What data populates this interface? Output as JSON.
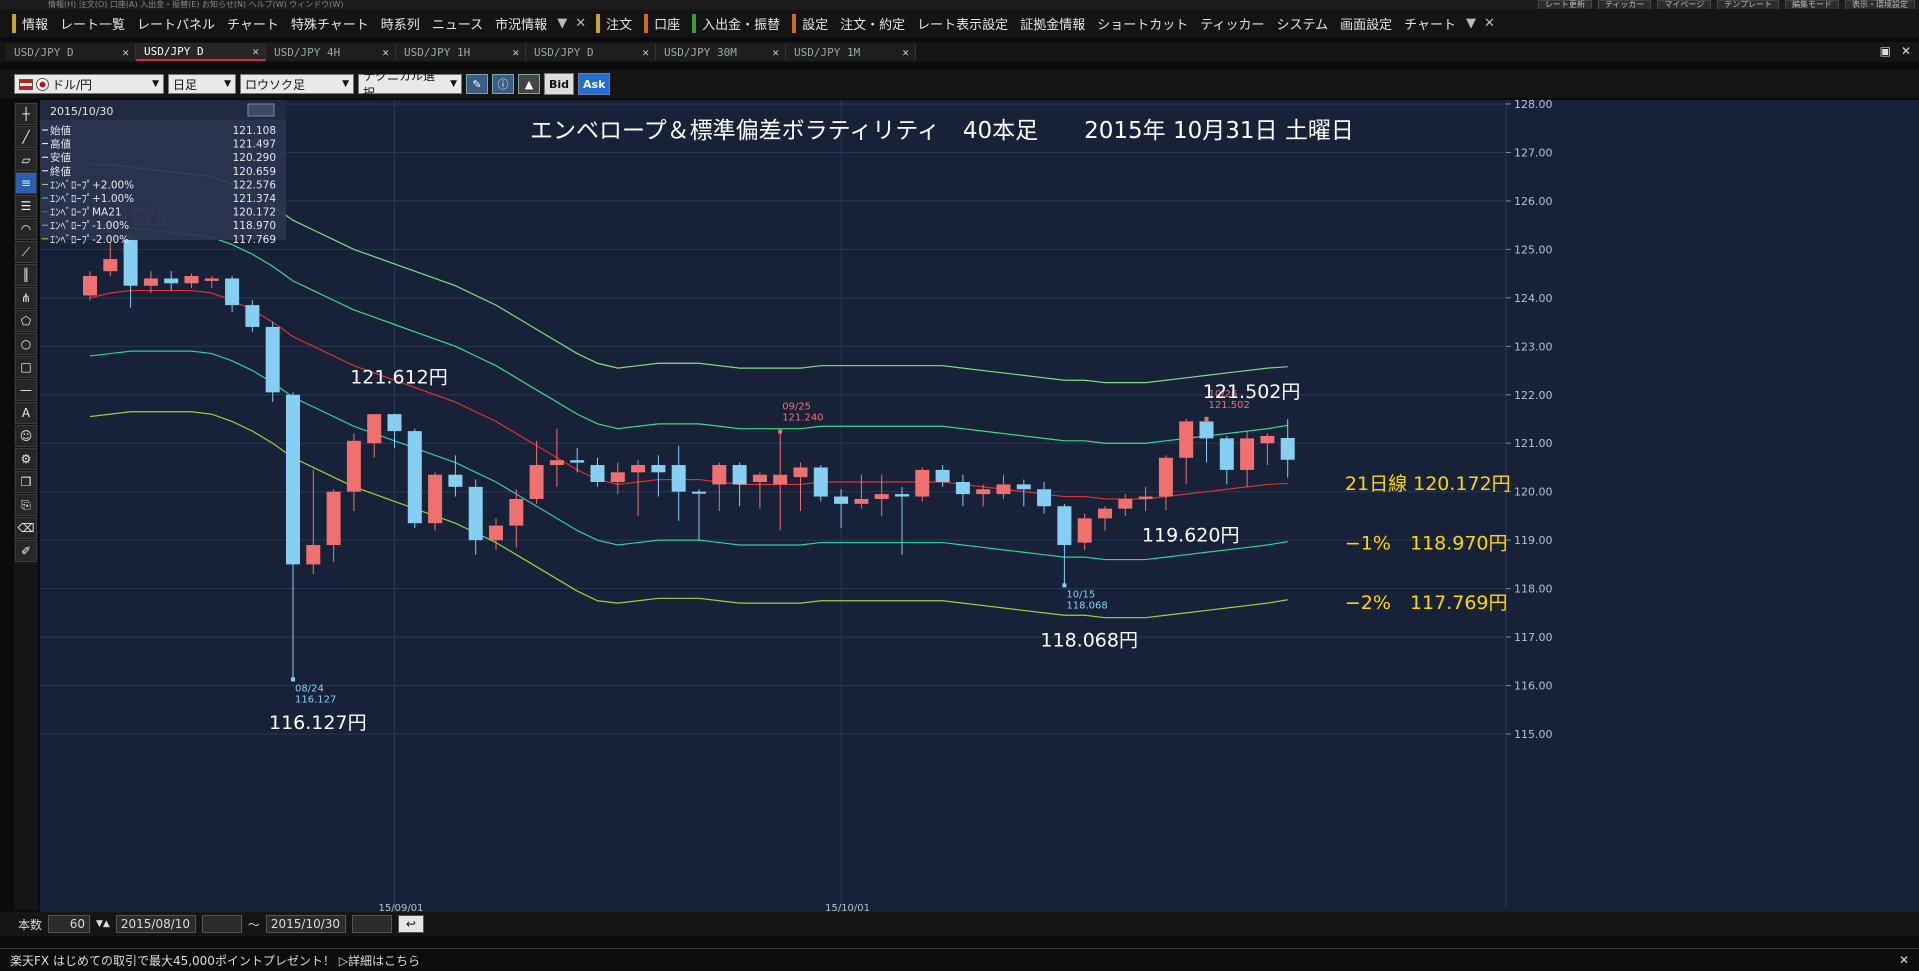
{
  "top_strip": {
    "left_items": [
      "情報(H)",
      "注文(O)",
      "口座(A)",
      "入出金・振替(E)",
      "お知らせ(N)",
      "ヘルプ(W)",
      "ウィンドウ(W)"
    ],
    "right_buttons": [
      "レート更新",
      "ティッカー",
      "マイページ",
      "テンプレート",
      "編集モード",
      "表示・環境設定"
    ]
  },
  "menu": {
    "group1": [
      "情報"
    ],
    "items": [
      "レート一覧",
      "レートパネル",
      "チャート",
      "特殊チャート",
      "時系列",
      "ニュース",
      "市況情報"
    ],
    "order": "注文",
    "account": "口座",
    "deposit": "入出金・振替",
    "settings": [
      "設定",
      "注文・約定",
      "レート表示設定",
      "証拠金情報",
      "ショートカット",
      "ティッカー",
      "システム",
      "画面設定",
      "チャート"
    ]
  },
  "tabs": [
    {
      "label": "USD/JPY D",
      "active": false
    },
    {
      "label": "USD/JPY D",
      "active": true
    },
    {
      "label": "USD/JPY 4H",
      "active": false
    },
    {
      "label": "USD/JPY 1H",
      "active": false
    },
    {
      "label": "USD/JPY D",
      "active": false
    },
    {
      "label": "USD/JPY 30M",
      "active": false
    },
    {
      "label": "USD/JPY 1M",
      "active": false
    }
  ],
  "chart_controls": {
    "pair": "ドル/円",
    "period": "日足",
    "chart_type": "ロウソク足",
    "technical": "テクニカル選択",
    "bid": "Bid",
    "ask": "Ask"
  },
  "info_panel": {
    "date": "2015/10/30",
    "rows": [
      {
        "label": "始値",
        "value": "121.108",
        "color": "#ffffff"
      },
      {
        "label": "高値",
        "value": "121.497",
        "color": "#ffffff"
      },
      {
        "label": "安値",
        "value": "120.290",
        "color": "#ffffff"
      },
      {
        "label": "終値",
        "value": "120.659",
        "color": "#ffffff"
      },
      {
        "label": "ｴﾝﾍﾞﾛｰﾌﾟ+2.00%",
        "value": "122.576",
        "color": "#8fe08f"
      },
      {
        "label": "ｴﾝﾍﾞﾛｰﾌﾟ+1.00%",
        "value": "121.374",
        "color": "#3ddc84"
      },
      {
        "label": "ｴﾝﾍﾞﾛｰﾌﾟMA21",
        "value": "120.172",
        "color": "#e03030"
      },
      {
        "label": "ｴﾝﾍﾞﾛｰﾌﾟ-1.00%",
        "value": "118.970",
        "color": "#3ddc84"
      },
      {
        "label": "ｴﾝﾍﾞﾛｰﾌﾟ-2.00%",
        "value": "117.769",
        "color": "#9bd33a"
      }
    ]
  },
  "bottom": {
    "count_label": "本数",
    "count": "60",
    "from": "2015/08/10",
    "tilde": "～",
    "to": "2015/10/30"
  },
  "news": "楽天FX はじめての取引で最大45,000ポイントプレゼント！ ▷詳細はこちら",
  "chart_data": {
    "type": "candlestick",
    "title": "エンベロープ＆標準偏差ボラティリティ　40本足　　2015年 10月31日 土曜日",
    "ylim": [
      115.0,
      128.0
    ],
    "yticks": [
      "115.00",
      "116.00",
      "117.00",
      "118.00",
      "119.00",
      "120.00",
      "121.00",
      "122.00",
      "123.00",
      "124.00",
      "125.00",
      "126.00",
      "127.00",
      "128.00"
    ],
    "xticks": [
      {
        "label": "15/09/01",
        "index": 15
      },
      {
        "label": "15/10/01",
        "index": 37
      }
    ],
    "colors": {
      "up": "#f07070",
      "down": "#86cff3"
    },
    "candles": [
      {
        "date": "08/10",
        "o": 124.05,
        "h": 124.55,
        "l": 123.95,
        "c": 124.45
      },
      {
        "date": "08/11",
        "o": 124.55,
        "h": 125.15,
        "l": 124.45,
        "c": 124.8
      },
      {
        "date": "08/12",
        "o": 125.2,
        "h": 125.281,
        "l": 123.8,
        "c": 124.25
      },
      {
        "date": "08/13",
        "o": 124.25,
        "h": 124.55,
        "l": 124.1,
        "c": 124.4
      },
      {
        "date": "08/14",
        "o": 124.4,
        "h": 124.55,
        "l": 124.15,
        "c": 124.3
      },
      {
        "date": "08/17",
        "o": 124.3,
        "h": 124.5,
        "l": 124.2,
        "c": 124.45
      },
      {
        "date": "08/18",
        "o": 124.35,
        "h": 124.45,
        "l": 124.2,
        "c": 124.4
      },
      {
        "date": "08/19",
        "o": 124.4,
        "h": 124.45,
        "l": 123.7,
        "c": 123.85
      },
      {
        "date": "08/20",
        "o": 123.85,
        "h": 123.95,
        "l": 123.3,
        "c": 123.4
      },
      {
        "date": "08/21",
        "o": 123.4,
        "h": 123.5,
        "l": 121.85,
        "c": 122.05
      },
      {
        "date": "08/24",
        "o": 122.0,
        "h": 122.05,
        "l": 116.127,
        "c": 118.5
      },
      {
        "date": "08/25",
        "o": 118.5,
        "h": 120.45,
        "l": 118.3,
        "c": 118.9
      },
      {
        "date": "08/26",
        "o": 118.9,
        "h": 120.05,
        "l": 118.55,
        "c": 120.0
      },
      {
        "date": "08/27",
        "o": 120.0,
        "h": 121.2,
        "l": 119.6,
        "c": 121.05
      },
      {
        "date": "08/28",
        "o": 121.0,
        "h": 121.6,
        "l": 120.7,
        "c": 121.6
      },
      {
        "date": "08/31",
        "o": 121.6,
        "h": 121.612,
        "l": 120.9,
        "c": 121.25
      },
      {
        "date": "09/01",
        "o": 121.25,
        "h": 121.3,
        "l": 119.25,
        "c": 119.35
      },
      {
        "date": "09/02",
        "o": 119.35,
        "h": 120.4,
        "l": 119.2,
        "c": 120.35
      },
      {
        "date": "09/03",
        "o": 120.35,
        "h": 120.75,
        "l": 119.9,
        "c": 120.1
      },
      {
        "date": "09/04",
        "o": 120.1,
        "h": 120.25,
        "l": 118.7,
        "c": 119.0
      },
      {
        "date": "09/07",
        "o": 119.0,
        "h": 119.45,
        "l": 118.8,
        "c": 119.3
      },
      {
        "date": "09/08",
        "o": 119.3,
        "h": 120.05,
        "l": 118.85,
        "c": 119.85
      },
      {
        "date": "09/09",
        "o": 119.85,
        "h": 121.05,
        "l": 119.75,
        "c": 120.55
      },
      {
        "date": "09/10",
        "o": 120.55,
        "h": 121.3,
        "l": 120.1,
        "c": 120.65
      },
      {
        "date": "09/11",
        "o": 120.65,
        "h": 120.9,
        "l": 120.4,
        "c": 120.6
      },
      {
        "date": "09/14",
        "o": 120.55,
        "h": 120.7,
        "l": 120.1,
        "c": 120.2
      },
      {
        "date": "09/15",
        "o": 120.2,
        "h": 120.6,
        "l": 119.95,
        "c": 120.4
      },
      {
        "date": "09/16",
        "o": 120.4,
        "h": 120.65,
        "l": 119.5,
        "c": 120.55
      },
      {
        "date": "09/17",
        "o": 120.55,
        "h": 120.75,
        "l": 119.9,
        "c": 120.4
      },
      {
        "date": "09/18",
        "o": 120.55,
        "h": 120.95,
        "l": 119.4,
        "c": 120.0
      },
      {
        "date": "09/21",
        "o": 120.0,
        "h": 120.05,
        "l": 119.0,
        "c": 119.98
      },
      {
        "date": "09/22",
        "o": 120.15,
        "h": 120.6,
        "l": 119.6,
        "c": 120.55
      },
      {
        "date": "09/23",
        "o": 120.55,
        "h": 120.6,
        "l": 119.7,
        "c": 120.15
      },
      {
        "date": "09/24",
        "o": 120.2,
        "h": 120.4,
        "l": 119.65,
        "c": 120.35
      },
      {
        "date": "09/25",
        "o": 120.15,
        "h": 121.24,
        "l": 119.2,
        "c": 120.35
      },
      {
        "date": "09/28",
        "o": 120.3,
        "h": 120.6,
        "l": 119.6,
        "c": 120.5
      },
      {
        "date": "09/29",
        "o": 120.5,
        "h": 120.55,
        "l": 119.8,
        "c": 119.9
      },
      {
        "date": "09/30",
        "o": 119.9,
        "h": 120.05,
        "l": 119.25,
        "c": 119.75
      },
      {
        "date": "10/01",
        "o": 119.75,
        "h": 120.35,
        "l": 119.65,
        "c": 119.85
      },
      {
        "date": "10/02",
        "o": 119.85,
        "h": 120.35,
        "l": 119.5,
        "c": 119.95
      },
      {
        "date": "10/05",
        "o": 119.95,
        "h": 120.1,
        "l": 118.7,
        "c": 119.9
      },
      {
        "date": "10/06",
        "o": 119.9,
        "h": 120.5,
        "l": 119.8,
        "c": 120.45
      },
      {
        "date": "10/07",
        "o": 120.45,
        "h": 120.55,
        "l": 120.1,
        "c": 120.2
      },
      {
        "date": "10/08",
        "o": 120.2,
        "h": 120.35,
        "l": 119.7,
        "c": 119.95
      },
      {
        "date": "10/09",
        "o": 119.95,
        "h": 120.15,
        "l": 119.7,
        "c": 120.05
      },
      {
        "date": "10/12",
        "o": 119.95,
        "h": 120.35,
        "l": 119.85,
        "c": 120.15
      },
      {
        "date": "10/13",
        "o": 120.15,
        "h": 120.25,
        "l": 119.7,
        "c": 120.05
      },
      {
        "date": "10/14",
        "o": 120.05,
        "h": 120.2,
        "l": 119.55,
        "c": 119.7
      },
      {
        "date": "10/15",
        "o": 119.7,
        "h": 119.75,
        "l": 118.068,
        "c": 118.9
      },
      {
        "date": "10/16",
        "o": 118.95,
        "h": 119.55,
        "l": 118.8,
        "c": 119.45
      },
      {
        "date": "10/19",
        "o": 119.45,
        "h": 119.7,
        "l": 119.2,
        "c": 119.65
      },
      {
        "date": "10/20",
        "o": 119.65,
        "h": 119.95,
        "l": 119.5,
        "c": 119.85
      },
      {
        "date": "10/21",
        "o": 119.85,
        "h": 120.1,
        "l": 119.6,
        "c": 119.9
      },
      {
        "date": "10/22",
        "o": 119.9,
        "h": 120.75,
        "l": 119.62,
        "c": 120.7
      },
      {
        "date": "10/23",
        "o": 120.7,
        "h": 121.5,
        "l": 120.15,
        "c": 121.45
      },
      {
        "date": "10/26",
        "o": 121.45,
        "h": 121.502,
        "l": 120.6,
        "c": 121.1
      },
      {
        "date": "10/27",
        "o": 121.1,
        "h": 121.15,
        "l": 120.15,
        "c": 120.45
      },
      {
        "date": "10/28",
        "o": 120.45,
        "h": 121.25,
        "l": 120.1,
        "c": 121.1
      },
      {
        "date": "10/29",
        "o": 121.0,
        "h": 121.2,
        "l": 120.55,
        "c": 121.15
      },
      {
        "date": "10/30",
        "o": 121.108,
        "h": 121.497,
        "l": 120.29,
        "c": 120.659
      }
    ],
    "series": [
      {
        "name": "ｴﾝﾍﾞﾛｰﾌﾟ+2.00%",
        "color": "#7fe07f",
        "values": [
          126.75,
          126.75,
          126.7,
          126.65,
          126.6,
          126.55,
          126.5,
          126.35,
          126.15,
          125.9,
          125.6,
          125.4,
          125.2,
          125.0,
          124.85,
          124.7,
          124.55,
          124.4,
          124.25,
          124.05,
          123.85,
          123.6,
          123.35,
          123.1,
          122.85,
          122.65,
          122.55,
          122.6,
          122.65,
          122.65,
          122.65,
          122.6,
          122.55,
          122.55,
          122.55,
          122.55,
          122.6,
          122.6,
          122.6,
          122.6,
          122.6,
          122.6,
          122.6,
          122.55,
          122.5,
          122.45,
          122.4,
          122.35,
          122.3,
          122.3,
          122.25,
          122.25,
          122.25,
          122.3,
          122.35,
          122.4,
          122.45,
          122.5,
          122.55,
          122.58
        ]
      },
      {
        "name": "ｴﾝﾍﾞﾛｰﾌﾟ+1.00%",
        "color": "#3ddc84",
        "values": [
          125.5,
          125.5,
          125.45,
          125.4,
          125.35,
          125.3,
          125.25,
          125.1,
          124.9,
          124.65,
          124.35,
          124.15,
          123.95,
          123.75,
          123.6,
          123.45,
          123.3,
          123.15,
          123.0,
          122.8,
          122.6,
          122.35,
          122.1,
          121.85,
          121.6,
          121.4,
          121.3,
          121.35,
          121.4,
          121.4,
          121.4,
          121.35,
          121.3,
          121.3,
          121.3,
          121.3,
          121.35,
          121.35,
          121.35,
          121.35,
          121.35,
          121.35,
          121.35,
          121.3,
          121.25,
          121.2,
          121.15,
          121.1,
          121.05,
          121.05,
          121.0,
          121.0,
          121.0,
          121.05,
          121.1,
          121.15,
          121.2,
          121.25,
          121.3,
          121.37
        ]
      },
      {
        "name": "ｴﾝﾍﾞﾛｰﾌﾟMA21",
        "color": "#e03030",
        "values": [
          124.0,
          124.1,
          124.15,
          124.15,
          124.15,
          124.15,
          124.1,
          123.95,
          123.75,
          123.5,
          123.2,
          123.0,
          122.8,
          122.6,
          122.45,
          122.3,
          122.15,
          122.0,
          121.85,
          121.65,
          121.45,
          121.2,
          120.95,
          120.7,
          120.45,
          120.25,
          120.15,
          120.2,
          120.25,
          120.25,
          120.25,
          120.2,
          120.15,
          120.15,
          120.15,
          120.15,
          120.2,
          120.2,
          120.2,
          120.2,
          120.2,
          120.2,
          120.2,
          120.15,
          120.1,
          120.05,
          120.0,
          119.95,
          119.9,
          119.9,
          119.85,
          119.85,
          119.85,
          119.9,
          119.95,
          120.0,
          120.05,
          120.1,
          120.15,
          120.17
        ]
      },
      {
        "name": "ｴﾝﾍﾞﾛｰﾌﾟ-1.00%",
        "color": "#2ecfa0",
        "values": [
          122.8,
          122.85,
          122.9,
          122.9,
          122.9,
          122.9,
          122.85,
          122.7,
          122.5,
          122.25,
          121.95,
          121.75,
          121.55,
          121.35,
          121.2,
          121.05,
          120.9,
          120.75,
          120.6,
          120.4,
          120.2,
          119.95,
          119.7,
          119.45,
          119.2,
          119.0,
          118.9,
          118.95,
          119.0,
          119.0,
          119.0,
          118.95,
          118.9,
          118.9,
          118.9,
          118.9,
          118.95,
          118.95,
          118.95,
          118.95,
          118.95,
          118.95,
          118.95,
          118.9,
          118.85,
          118.8,
          118.75,
          118.7,
          118.65,
          118.65,
          118.6,
          118.6,
          118.6,
          118.65,
          118.7,
          118.75,
          118.8,
          118.85,
          118.9,
          118.97
        ]
      },
      {
        "name": "ｴﾝﾍﾞﾛｰﾌﾟ-2.00%",
        "color": "#9bd33a",
        "values": [
          121.55,
          121.6,
          121.65,
          121.65,
          121.65,
          121.65,
          121.6,
          121.45,
          121.25,
          121.0,
          120.7,
          120.5,
          120.3,
          120.1,
          119.95,
          119.8,
          119.65,
          119.5,
          119.35,
          119.15,
          118.95,
          118.7,
          118.45,
          118.2,
          117.95,
          117.75,
          117.7,
          117.75,
          117.8,
          117.8,
          117.8,
          117.75,
          117.7,
          117.7,
          117.7,
          117.7,
          117.75,
          117.75,
          117.75,
          117.75,
          117.75,
          117.75,
          117.75,
          117.7,
          117.65,
          117.6,
          117.55,
          117.5,
          117.45,
          117.45,
          117.4,
          117.4,
          117.4,
          117.45,
          117.5,
          117.55,
          117.6,
          117.65,
          117.7,
          117.77
        ]
      }
    ],
    "marker_labels": [
      {
        "index": 2,
        "date": "08/12",
        "value": "125.281",
        "pos": "above",
        "color": "#f07070"
      },
      {
        "index": 10,
        "date": "08/24",
        "value": "116.127",
        "pos": "below",
        "color": "#86cff3"
      },
      {
        "index": 34,
        "date": "09/25",
        "value": "121.240",
        "pos": "above",
        "color": "#f07070"
      },
      {
        "index": 48,
        "date": "10/15",
        "value": "118.068",
        "pos": "below",
        "color": "#86cff3"
      },
      {
        "index": 55,
        "date": "10/26",
        "value": "121.502",
        "pos": "above",
        "color": "#f07070"
      }
    ],
    "annotations": [
      {
        "text": "121.612円",
        "index": 14,
        "price": 122.38,
        "color": "#ffffff"
      },
      {
        "text": "116.127円",
        "index": 10,
        "price": 115.25,
        "color": "#ffffff"
      },
      {
        "text": "121.502円",
        "index": 56,
        "price": 122.08,
        "color": "#ffffff"
      },
      {
        "text": "119.620円",
        "index": 53,
        "price": 119.12,
        "color": "#ffffff"
      },
      {
        "text": "118.068円",
        "index": 48,
        "price": 116.95,
        "color": "#ffffff"
      },
      {
        "text": "21日線 120.172円",
        "index": 63,
        "price": 120.18,
        "color": "#ffd700"
      },
      {
        "text": "−1%　118.970円",
        "index": 63,
        "price": 118.95,
        "color": "#ffd700"
      },
      {
        "text": "−2%　117.769円",
        "index": 63,
        "price": 117.72,
        "color": "#ffd700"
      }
    ]
  }
}
